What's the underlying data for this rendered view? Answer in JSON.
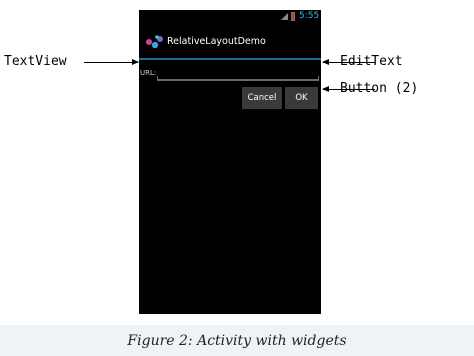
{
  "status_bar": {
    "time": "5:55",
    "signal_icon": "signal-icon",
    "battery_icon": "battery-icon",
    "accent_color": "#33b5e5"
  },
  "action_bar": {
    "app_icon": "app-icon",
    "title": "RelativeLayoutDemo"
  },
  "form": {
    "url_label": "URL:",
    "url_value": "",
    "cancel_label": "Cancel",
    "ok_label": "OK"
  },
  "annotations": {
    "textview": "TextView",
    "edittext": "EditText",
    "button": "Button (2)"
  },
  "caption": "Figure 2: Activity with widgets"
}
